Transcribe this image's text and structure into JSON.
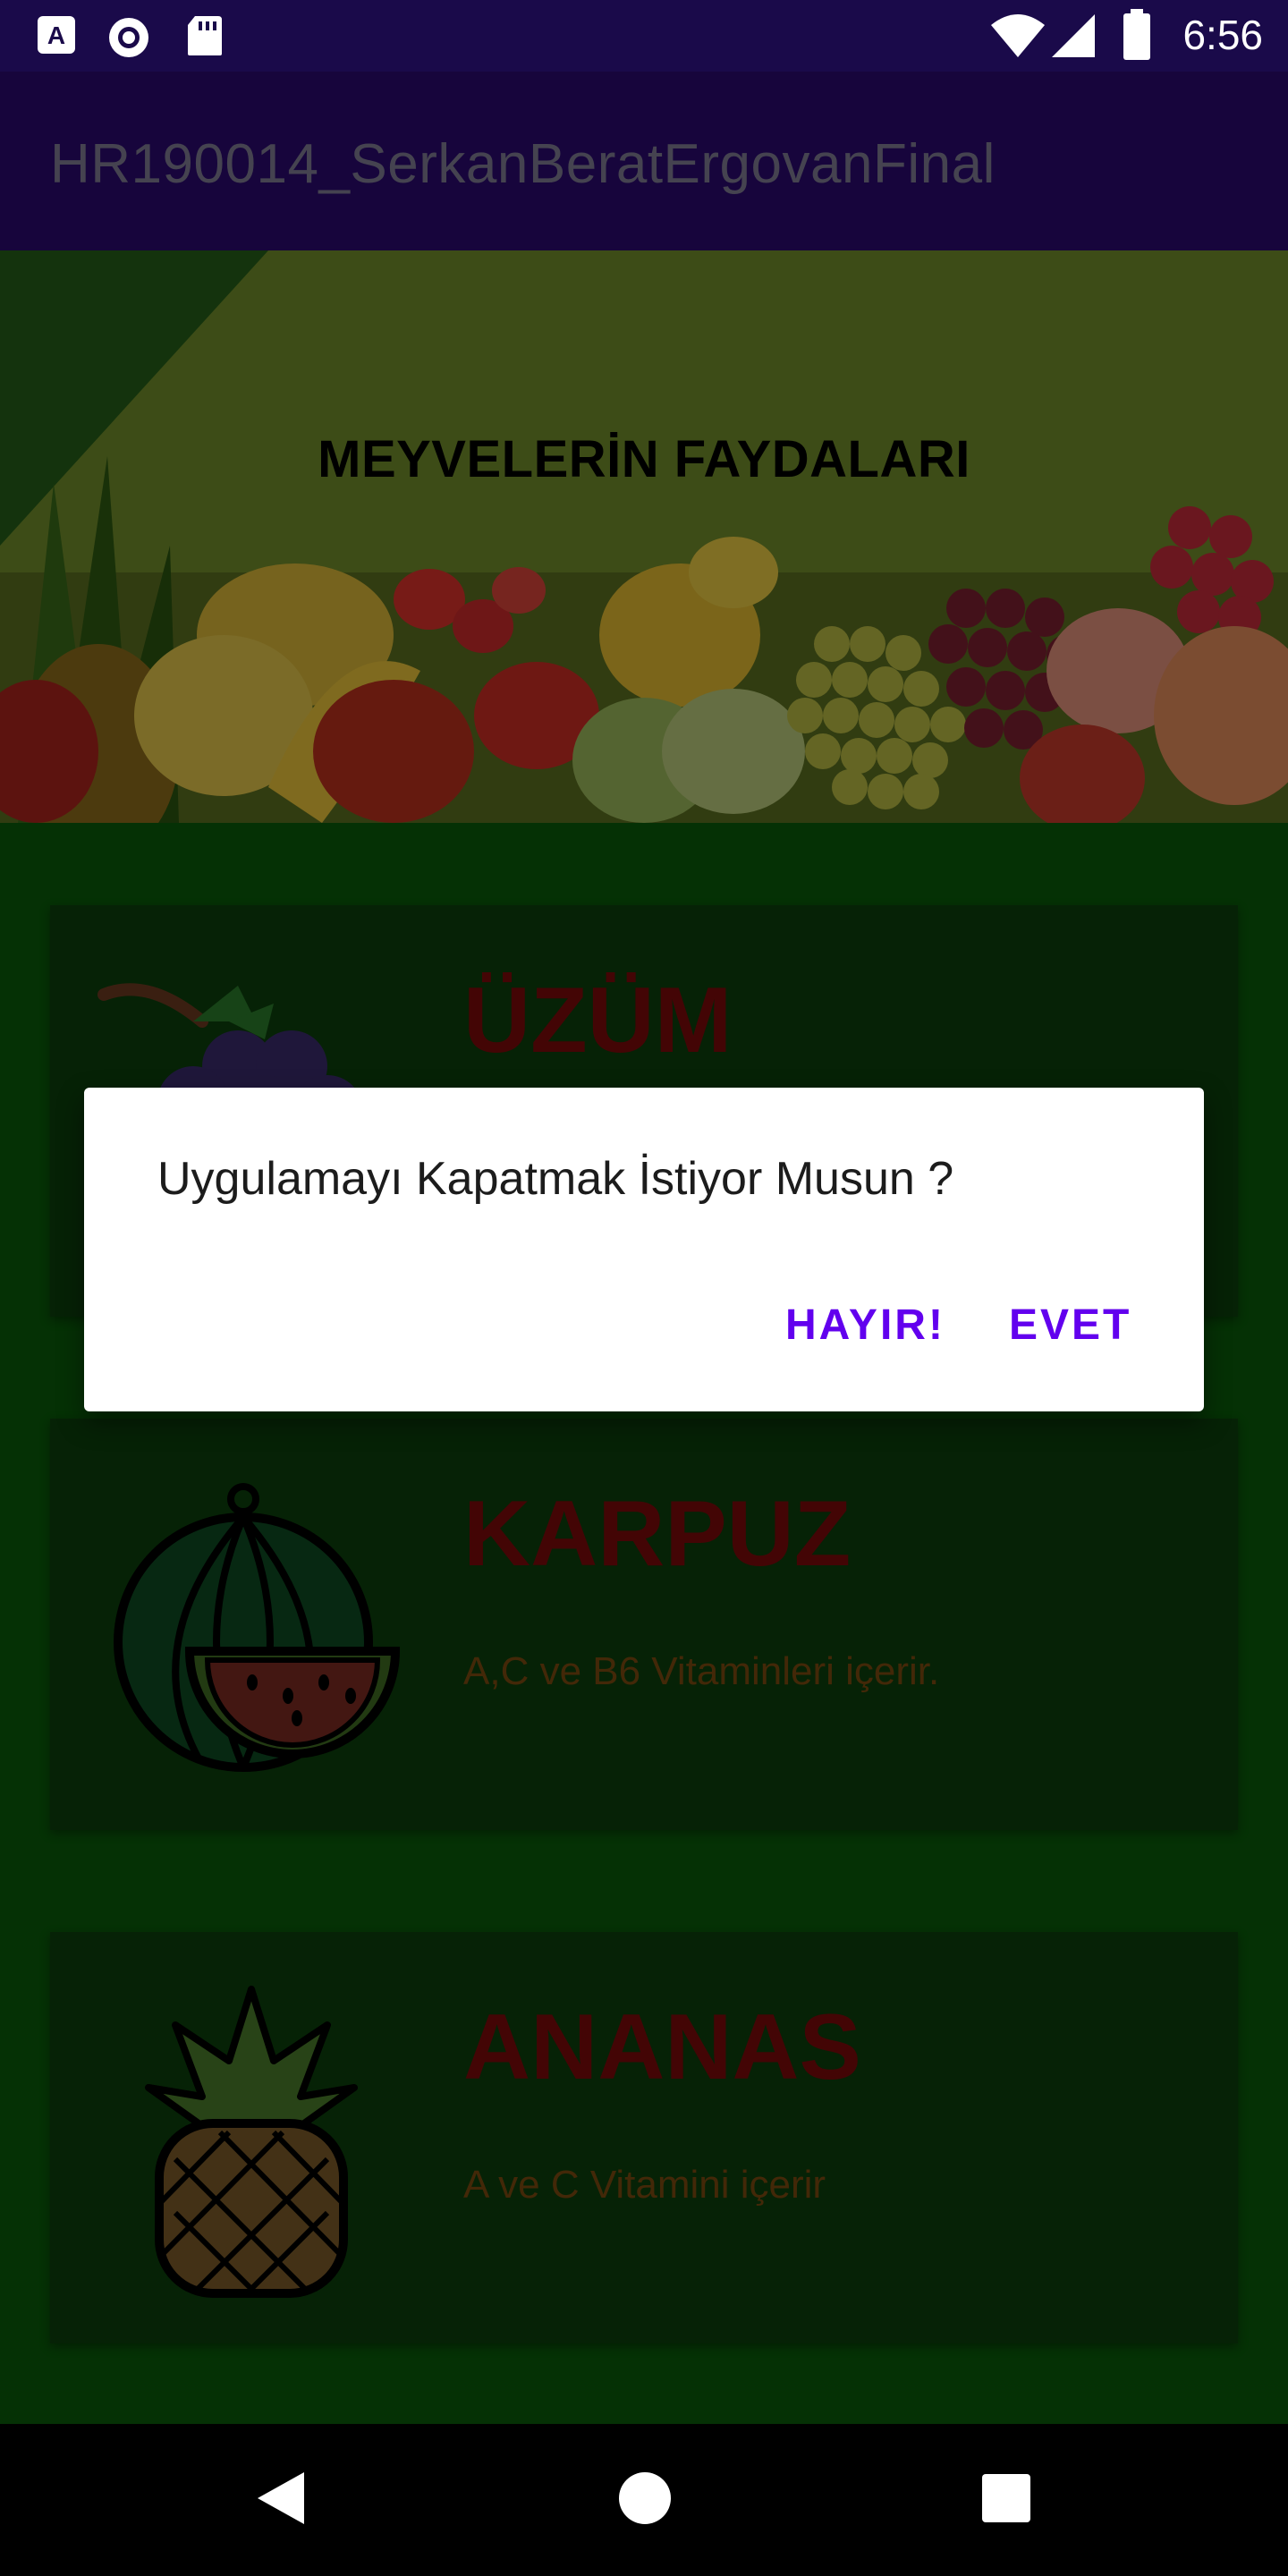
{
  "status_bar": {
    "time": "6:56",
    "icons": [
      "accessibility-a-icon",
      "record-icon",
      "sd-card-icon",
      "wifi-icon",
      "signal-icon",
      "battery-icon"
    ]
  },
  "app_bar": {
    "title": "HR190014_SerkanBeratErgovanFinal"
  },
  "banner": {
    "title": "MEYVELERİN FAYDALARI"
  },
  "cards": [
    {
      "title": "ÜZÜM",
      "description": "",
      "icon": "grape-icon"
    },
    {
      "title": "KARPUZ",
      "description": "A,C ve B6 Vitaminleri içerir.",
      "icon": "watermelon-icon"
    },
    {
      "title": "ANANAS",
      "description": "A ve C Vitamini içerir",
      "icon": "pineapple-icon"
    }
  ],
  "dialog": {
    "message": "Uygulamayı Kapatmak İstiyor Musun ?",
    "negative_label": "HAYIR!",
    "positive_label": "EVET"
  },
  "colors": {
    "status_bar": "#1a0a4a",
    "app_bar": "#2a0a6e",
    "content_bg": "#0a5a0a",
    "card_bg": "#0b3f0b",
    "card_title": "#7a0a0a",
    "card_desc": "#7a4a10",
    "dialog_button": "#6200ee"
  },
  "nav_bar": {
    "buttons": [
      "back-icon",
      "home-icon",
      "recents-icon"
    ]
  }
}
